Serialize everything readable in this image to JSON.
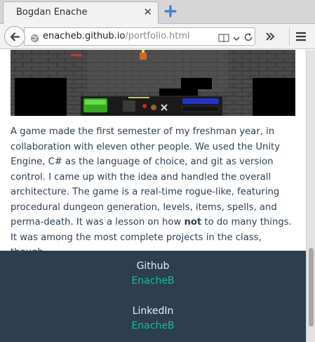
{
  "browser": {
    "tab_title": "Bogdan Enache",
    "url_domain": "enacheb.github.io",
    "url_path": "/portfolio.html"
  },
  "content": {
    "desc_part1": "A game made the first semester of my freshman year, in collaboration with eleven other people. We used the Unity Engine, C# as the language of choice, and git as version control. I came up with the idea and handled the overall architecture. The game is a real-time rogue-like, featuring procedural dungeon generation, levels, items, spells, and perma-death. It was a lesson on how ",
    "desc_bold": "not",
    "desc_part2": " to do many things. It was among the most complete projects in the class, though."
  },
  "footer": {
    "github_label": "Github",
    "github_link": "EnacheB",
    "linkedin_label": "LinkedIn",
    "linkedin_link": "EnacheB"
  },
  "icons": {
    "tab_close": "close-icon",
    "new_tab": "plus-icon",
    "back": "back-arrow-icon",
    "site_identity": "globe-icon",
    "reader_view": "reader-view-icon",
    "history_dropdown": "chevron-down-icon",
    "reload": "reload-icon",
    "overflow": "double-chevron-right-icon",
    "menu": "hamburger-menu-icon"
  },
  "colors": {
    "footer_bg": "#2c3e50",
    "footer_link": "#1abc9c",
    "body_text": "#2c3e50"
  }
}
